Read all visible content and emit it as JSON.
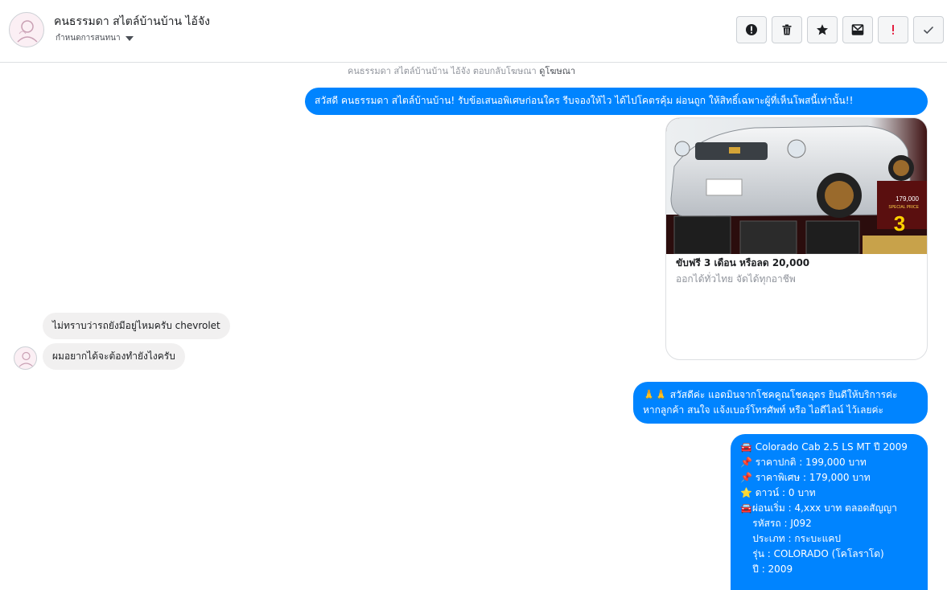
{
  "header": {
    "page_name": "คนธรรมดา สไตล์บ้านบ้าน ไอ้จัง",
    "assign_label": "กำหนดการสนทนา",
    "actions": [
      {
        "name": "report-icon"
      },
      {
        "name": "trash-icon"
      },
      {
        "name": "star-icon"
      },
      {
        "name": "mark-unread-icon"
      },
      {
        "name": "spam-icon"
      },
      {
        "name": "done-icon"
      }
    ]
  },
  "thread": {
    "ad_note": "คนธรรมดา สไตล์บ้านบ้าน ไอ้จัง ตอบกลับโฆษณา",
    "ad_link": "ดูโฆษณา",
    "outgoing_1": "สวัสดี คนธรรมดา สไตล์บ้านบ้าน! รับข้อเสนอพิเศษก่อนใคร รีบจองให้ไว ได้ไปโคตรคุ้ม ผ่อนถูก ให้สิทธิ์เฉพาะผู้ที่เห็นโพสนี้เท่านั้น!!",
    "card": {
      "title": "ขับฟรี 3 เดือน หรือลด 20,000",
      "subtitle": "ออกได้ทั่วไทย จัดได้ทุกอาชีพ",
      "image_price": "179,000",
      "image_badge": "SPECIAL PRICE",
      "image_big_number": "3"
    },
    "incoming_1": "ไม่ทราบว่ารถยังมีอยู่ไหมครับ chevrolet",
    "incoming_2": "ผมอยากได้จะต้องทำยังไงครับ",
    "outgoing_2": {
      "line1": "🙏🙏 สวัสดีค่ะ แอดมินจากโชคคูณโชคอุดร ยินดีให้บริการค่ะ",
      "line2": "หากลูกค้า สนใจ แจ้งเบอร์โทรศัพท์ หรือ ไอดีไลน์  ไว้เลยค่ะ"
    },
    "outgoing_3": {
      "lines": [
        "🚘 Colorado Cab 2.5 LS MT ปี 2009",
        "📌 ราคาปกติ : 199,000 บาท",
        "📌 ราคาพิเศษ : 179,000 บาท",
        "⭐ ดาวน์ : 0 บาท",
        "🚘ผ่อนเริ่ม : 4,xxx บาท ตลอดสัญญา",
        "    รหัสรถ : J092",
        "    ประเภท : กระบะแคป",
        "    รุ่น : COLORADO (โคโลราโด)",
        "    ปี : 2009"
      ]
    }
  },
  "colors": {
    "accent_blue": "#0084ff",
    "incoming_bg": "#f1f0f0"
  }
}
